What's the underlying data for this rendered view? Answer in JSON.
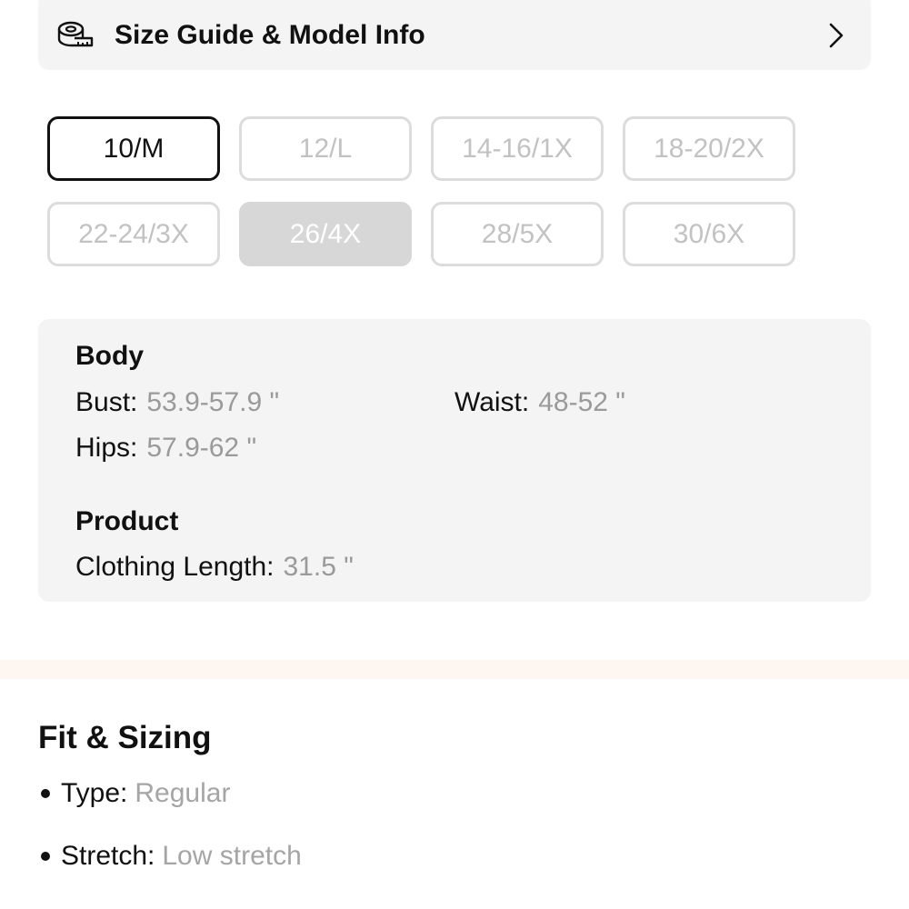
{
  "size_guide": {
    "title": "Size Guide & Model Info",
    "icon": "measuring-tape-icon"
  },
  "sizes": [
    {
      "label": "10/M",
      "state": "selected"
    },
    {
      "label": "12/L",
      "state": "available"
    },
    {
      "label": "14-16/1X",
      "state": "available"
    },
    {
      "label": "18-20/2X",
      "state": "available"
    },
    {
      "label": "22-24/3X",
      "state": "available"
    },
    {
      "label": "26/4X",
      "state": "unavailable"
    },
    {
      "label": "28/5X",
      "state": "available"
    },
    {
      "label": "30/6X",
      "state": "available"
    }
  ],
  "measurements": {
    "body_heading": "Body",
    "bust_label": "Bust:",
    "bust_value": "53.9-57.9 \"",
    "waist_label": "Waist:",
    "waist_value": "48-52 \"",
    "hips_label": "Hips:",
    "hips_value": "57.9-62 \"",
    "product_heading": "Product",
    "length_label": "Clothing Length:",
    "length_value": "31.5 \""
  },
  "fit": {
    "title": "Fit & Sizing",
    "items": [
      {
        "label": "Type:",
        "value": "Regular"
      },
      {
        "label": "Stretch:",
        "value": "Low stretch"
      }
    ]
  },
  "colors": {
    "band": "#fdf6f1",
    "card": "#f4f4f4",
    "muted_text": "#9a9a9a"
  }
}
